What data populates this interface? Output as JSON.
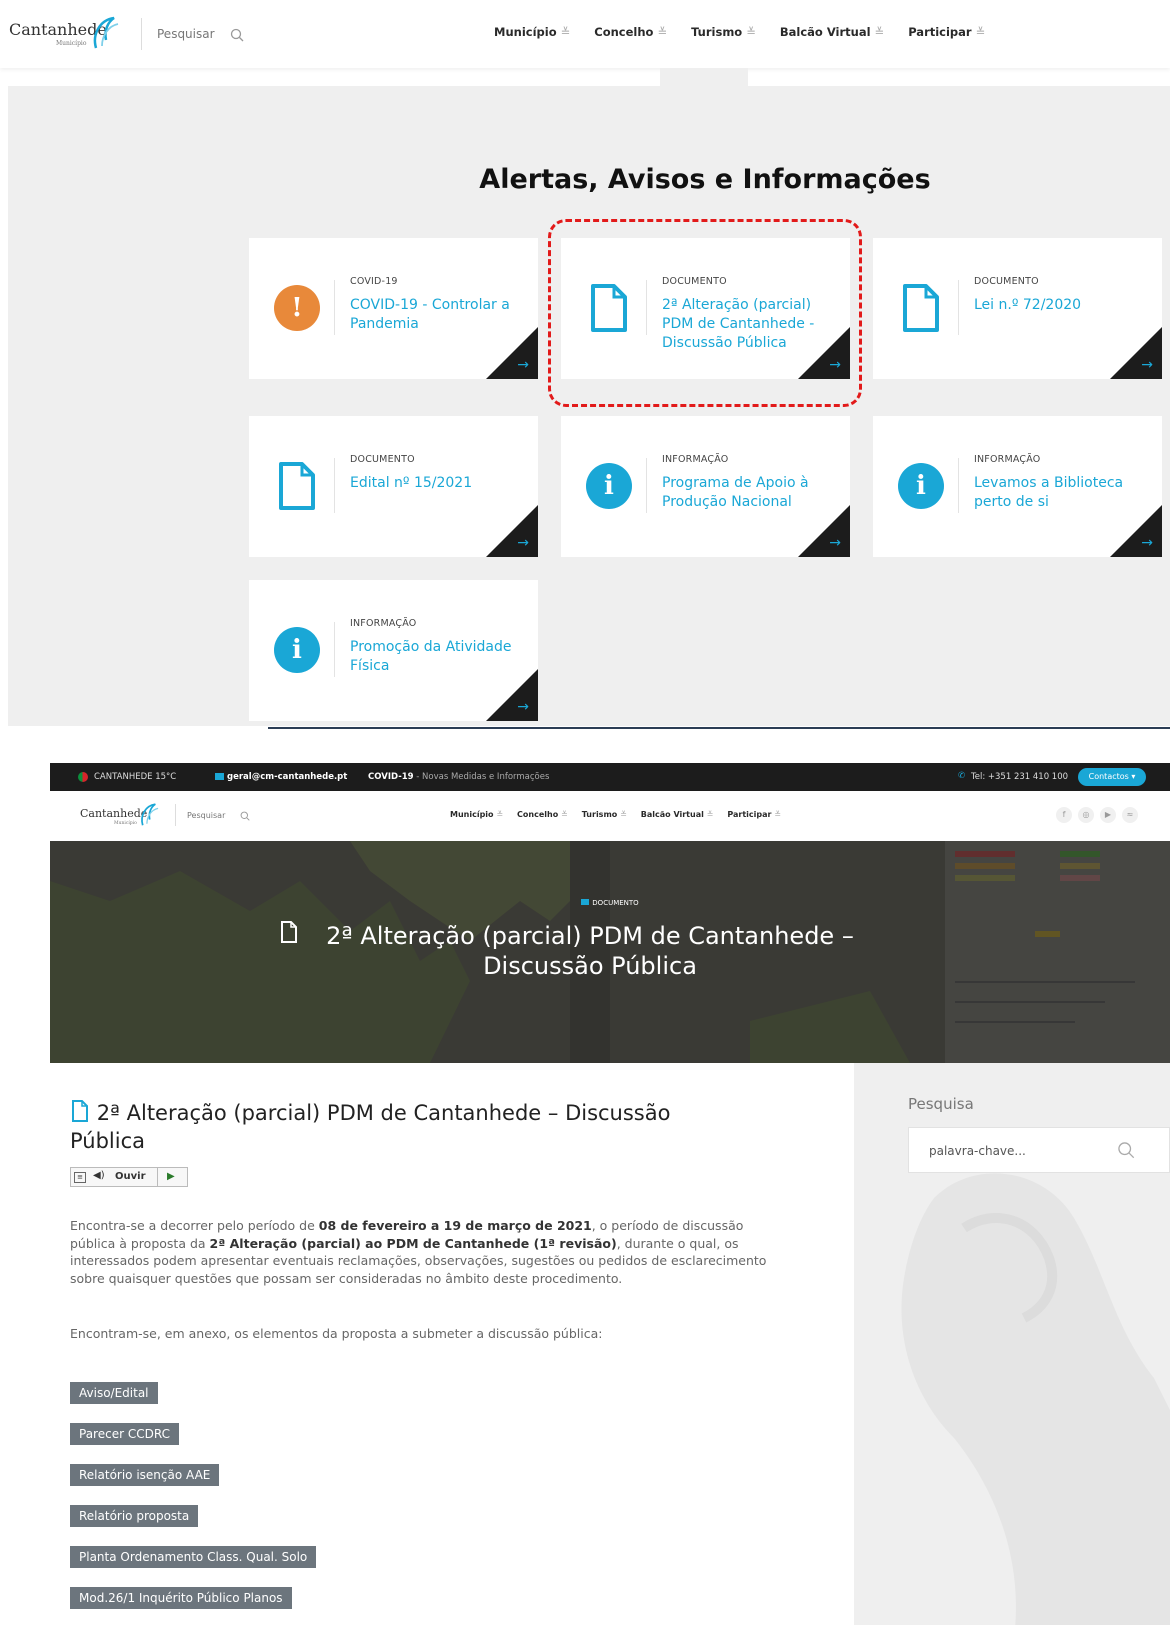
{
  "header": {
    "logo_text": "Cantanhede",
    "logo_subtext": "Município",
    "search_label": "Pesquisar",
    "menu": [
      {
        "label": "Município"
      },
      {
        "label": "Concelho"
      },
      {
        "label": "Turismo"
      },
      {
        "label": "Balcão Virtual"
      },
      {
        "label": "Participar"
      }
    ]
  },
  "alerts": {
    "title": "Alertas, Avisos e Informações",
    "cards": [
      {
        "category": "COVID-19",
        "title": "COVID-19 - Controlar a Pandemia",
        "icon": "exclamation-icon",
        "icon_color": "#e8893a"
      },
      {
        "category": "DOCUMENTO",
        "title": "2ª Alteração (parcial) PDM de Cantanhede - Discussão Pública",
        "icon": "document-icon",
        "icon_color": "#1aa7d6"
      },
      {
        "category": "DOCUMENTO",
        "title": "Lei n.º 72/2020",
        "icon": "document-icon",
        "icon_color": "#1aa7d6"
      },
      {
        "category": "DOCUMENTO",
        "title": "Edital nº 15/2021",
        "icon": "document-icon",
        "icon_color": "#1aa7d6"
      },
      {
        "category": "INFORMAÇÃO",
        "title": "Programa de Apoio à Produção Nacional",
        "icon": "info-icon",
        "icon_color": "#1aa7d6"
      },
      {
        "category": "INFORMAÇÃO",
        "title": "Levamos a Biblioteca perto de si",
        "icon": "info-icon",
        "icon_color": "#1aa7d6"
      },
      {
        "category": "INFORMAÇÃO",
        "title": "Promoção da Atividade Física",
        "icon": "info-icon",
        "icon_color": "#1aa7d6"
      }
    ],
    "arrow": "→"
  },
  "topbar": {
    "weather": "CANTANHEDE 15°C",
    "email": "geral@cm-cantanhede.pt",
    "covid_strong": "COVID-19",
    "covid_text": " - Novas Medidas e Informações",
    "phone": "Tel: +351 231 410 100",
    "contacts_button": "Contactos"
  },
  "hero": {
    "category": "DOCUMENTO",
    "title": "2ª Alteração (parcial) PDM de Cantanhede – Discussão Pública"
  },
  "article": {
    "title": "2ª Alteração (parcial) PDM de Cantanhede – Discussão Pública",
    "ouvir_label": "Ouvir",
    "p1_a": "Encontra-se a decorrer pelo período de ",
    "p1_b": "08 de fevereiro a 19 de  março  de 2021",
    "p1_c": ", o período de discussão pública à proposta da ",
    "p1_d": "2ª Alteração (parcial) ao PDM de Cantanhede (1ª revisão)",
    "p1_e": ", durante o  qual,  os interessados podem apresentar eventuais reclamações, observações, sugestões ou pedidos de esclarecimento sobre quaisquer questões que possam ser consideradas no âmbito deste procedimento.",
    "p2": "Encontram-se, em anexo, os elementos da proposta a submeter a discussão pública:",
    "attachments": [
      "Aviso/Edital",
      "Parecer CCDRC",
      "Relatório isenção AAE",
      "Relatório proposta",
      "Planta Ordenamento Class. Qual. Solo",
      "Mod.26/1 Inquérito Público Planos"
    ]
  },
  "sidebar": {
    "search_label": "Pesquisa",
    "search_placeholder": "palavra-chave..."
  }
}
